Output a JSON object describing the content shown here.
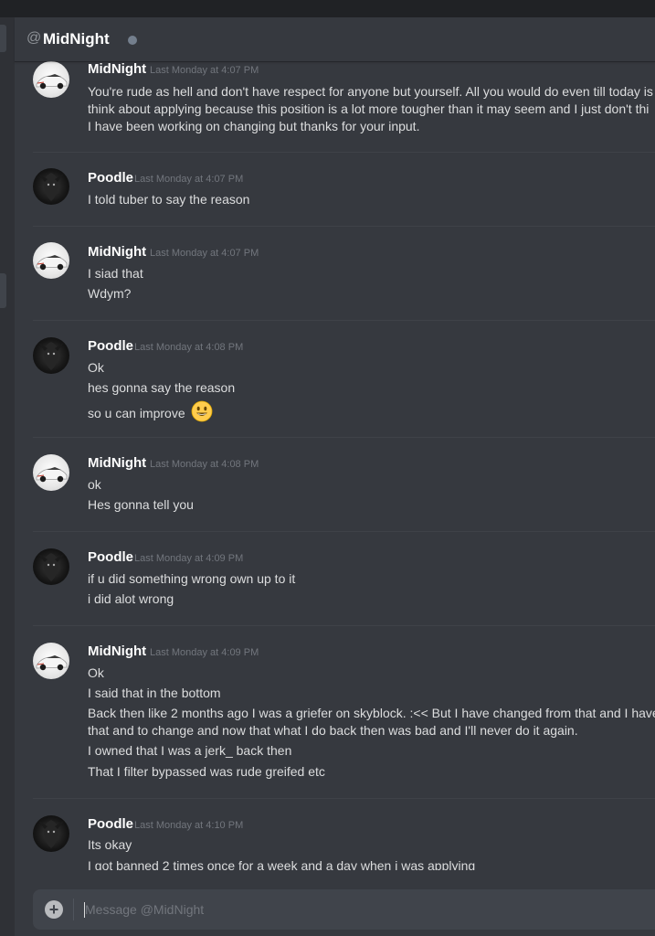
{
  "header": {
    "at_symbol": "@",
    "name": "MidNight"
  },
  "composer": {
    "placeholder": "Message @MidNight"
  },
  "groups": [
    {
      "author": "MidNight",
      "timestamp": "Last Monday at 4:07 PM",
      "lines": [
        "You're rude as hell and don't have respect for anyone but yourself. All you would do even till today is",
        "think about applying because this position is a lot more tougher than it may seem and I just don't thi",
        "I have been working on changing but thanks for your input."
      ]
    },
    {
      "author": "Poodle",
      "timestamp": "Last Monday at 4:07 PM",
      "lines": [
        "I told tuber to say the reason"
      ]
    },
    {
      "author": "MidNight",
      "timestamp": "Last Monday at 4:07 PM",
      "lines": [
        "I siad that",
        "Wdym?"
      ]
    },
    {
      "author": "Poodle",
      "timestamp": "Last Monday at 4:08 PM",
      "lines": [
        "Ok",
        "hes gonna say the reason",
        "so u can improve"
      ]
    },
    {
      "author": "MidNight",
      "timestamp": "Last Monday at 4:08 PM",
      "lines": [
        "ok",
        "Hes gonna tell you"
      ]
    },
    {
      "author": "Poodle",
      "timestamp": "Last Monday at 4:09 PM",
      "lines": [
        "if u did something wrong own up to it",
        "i did alot wrong"
      ]
    },
    {
      "author": "MidNight",
      "timestamp": "Last Monday at 4:09 PM",
      "lines": [
        "Ok",
        "I said that in the bottom",
        "Back then like 2 months ago I was a griefer on skyblock. :<< But I have changed from that and I have",
        "that and to change and now that what I do back then was bad and I'll never do it again.",
        "I owned that I was a jerk_ back then",
        "That I filter bypassed was rude greifed etc"
      ]
    },
    {
      "author": "Poodle",
      "timestamp": "Last Monday at 4:10 PM",
      "lines": [
        "Its okay",
        "I got banned 2 times once for a week and a day when i was applying"
      ]
    }
  ]
}
